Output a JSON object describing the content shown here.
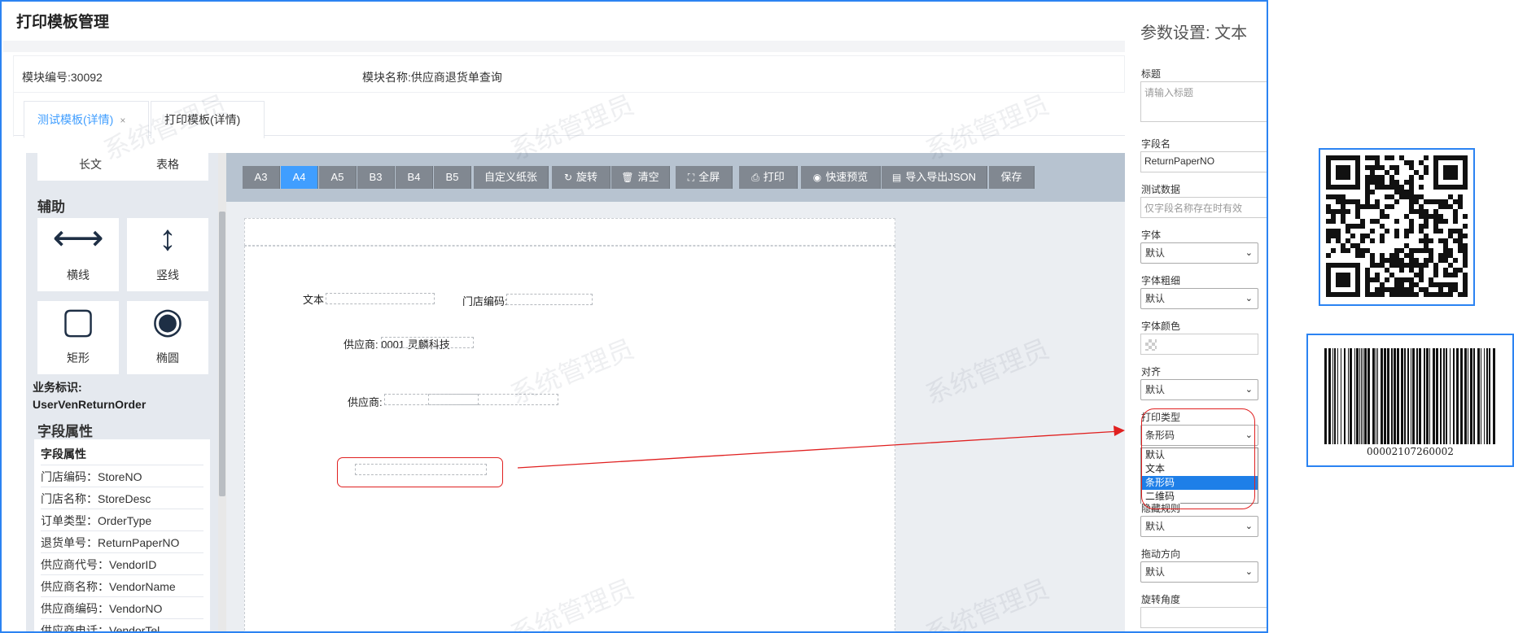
{
  "page": {
    "title": "打印模板管理"
  },
  "info": {
    "module_code": "模块编号:30092",
    "module_name": "模块名称:供应商退货单查询"
  },
  "tabs": [
    {
      "label": "测试模板(详情)",
      "close": "×",
      "active": true
    },
    {
      "label": "打印模板(详情)",
      "active": false
    }
  ],
  "left_panel": {
    "tools_top": [
      "长文",
      "表格"
    ],
    "aux_title": "辅助",
    "aux_tools": [
      {
        "label": "横线",
        "icon": "horizontal-line-icon",
        "glyph": "⟷"
      },
      {
        "label": "竖线",
        "icon": "vertical-line-icon",
        "glyph": "↕"
      },
      {
        "label": "矩形",
        "icon": "rectangle-icon",
        "glyph": "▢"
      },
      {
        "label": "椭圆",
        "icon": "ellipse-icon",
        "glyph": "◉"
      }
    ],
    "biz_label": "业务标识:",
    "biz_value": "UserVenReturnOrder",
    "fields_title": "字段属性",
    "fields_header": "字段属性",
    "fields": [
      "门店编码：StoreNO",
      "门店名称：StoreDesc",
      "订单类型：OrderType",
      "退货单号：ReturnPaperNO",
      "供应商代号：VendorID",
      "供应商名称：VendorName",
      "供应商编码：VendorNO",
      "供应商电话：VendorTel"
    ]
  },
  "toolbar": {
    "paper_sizes": [
      "A3",
      "A4",
      "A5",
      "B3",
      "B4",
      "B5"
    ],
    "active_size": "A4",
    "custom": "自定义纸张",
    "rotate": "旋转",
    "clear": "清空",
    "fullscreen": "全屏",
    "print": "打印",
    "preview": "快速预览",
    "import_export": "导入导出JSON",
    "save": "保存"
  },
  "canvas": {
    "text_el": "文本",
    "store_code": "门店编码:",
    "supplier1": "供应商: 0001 灵麟科技",
    "supplier2": "供应商:",
    "watermark": "系统管理员"
  },
  "props": {
    "title": "参数设置: 文本",
    "title_label": "标题",
    "title_placeholder": "请输入标题",
    "field_label": "字段名",
    "field_value": "ReturnPaperNO",
    "test_label": "测试数据",
    "test_placeholder": "仅字段名称存在时有效",
    "font_label": "字体",
    "font_value": "默认",
    "weight_label": "字体粗细",
    "weight_value": "默认",
    "color_label": "字体颜色",
    "align_label": "对齐",
    "align_value": "默认",
    "print_type_label": "打印类型",
    "print_type_value": "条形码",
    "print_type_options": [
      "默认",
      "文本",
      "条形码",
      "二维码"
    ],
    "print_type_selected": "条形码",
    "hide_label": "隐藏规则",
    "hide_value": "默认",
    "drag_label": "拖动方向",
    "drag_value": "默认",
    "rotate_label": "旋转角度"
  },
  "barcode": {
    "number": "00002107260002"
  },
  "colors": {
    "accent": "#409eff",
    "highlight_border": "#e02020",
    "card_border": "#2b83f2",
    "toolbar_button": "#818891"
  }
}
